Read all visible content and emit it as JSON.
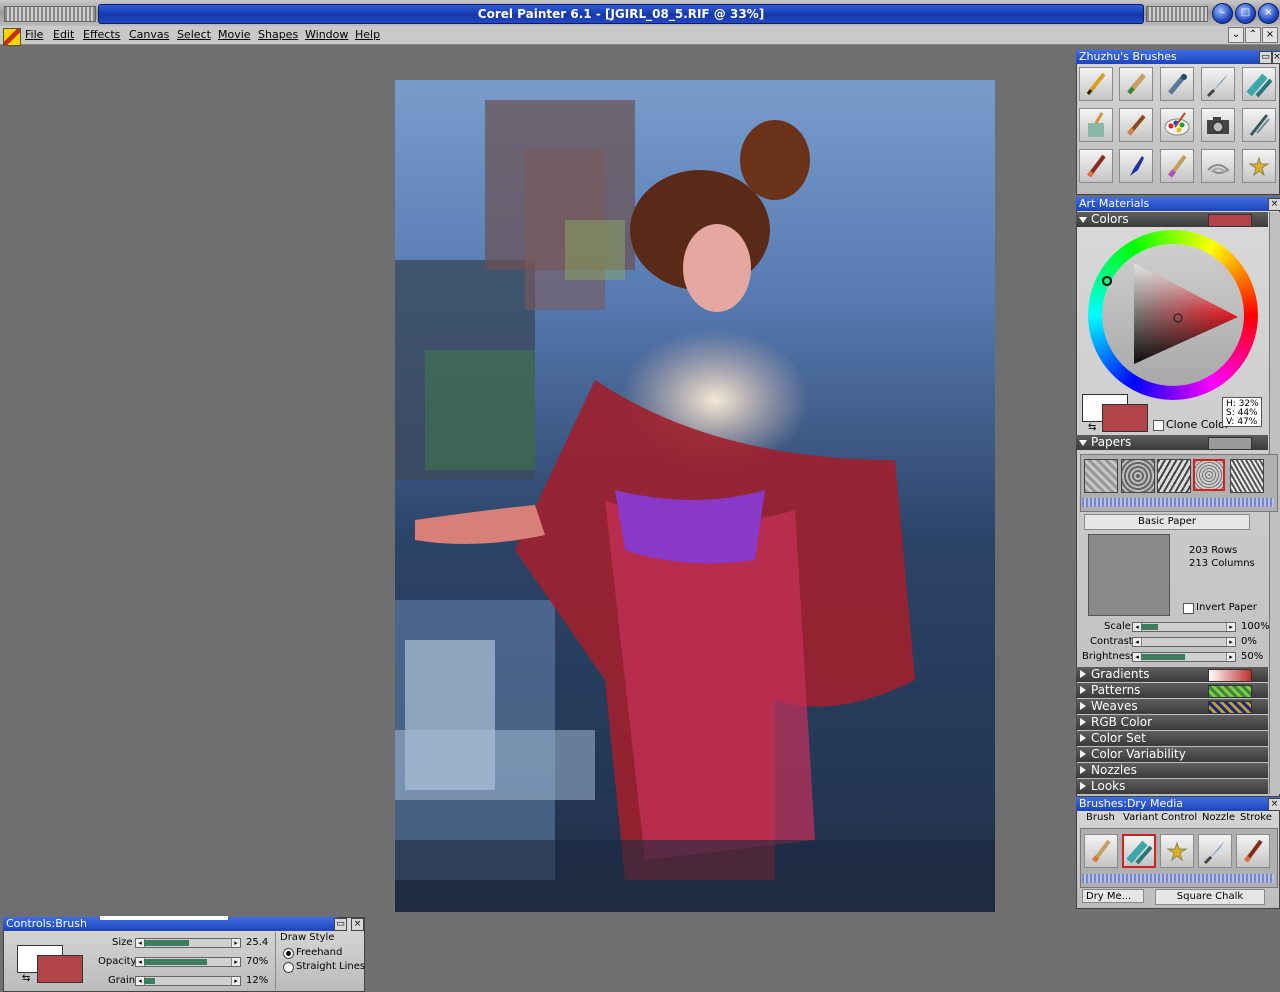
{
  "window": {
    "title": "Corel Painter 6.1 - [JGIRL_08_5.RIF @ 33%]"
  },
  "menu": [
    "File",
    "Edit",
    "Effects",
    "Canvas",
    "Select",
    "Movie",
    "Shapes",
    "Window",
    "Help"
  ],
  "brushes_palette": {
    "title": "Zhuzhu's Brushes",
    "tools": [
      "pencil-icon",
      "felt-pen-icon",
      "airbrush-icon",
      "palette-knife-icon",
      "chalk-icon",
      "paint-bucket-icon",
      "oil-brush-icon",
      "color-wheel-icon",
      "camera-icon",
      "pen-nib-icon",
      "brush-icon",
      "ink-pen-icon",
      "watercolor-icon",
      "liquid-swirl-icon",
      "image-hose-icon"
    ]
  },
  "art_materials": {
    "title": "Art Materials",
    "colors": {
      "label": "Colors",
      "clone_color_label": "Clone Color",
      "hsv": [
        "H: 32%",
        "S: 44%",
        "V: 47%"
      ],
      "primary_color": "#b04448",
      "secondary_color": "#ffffff"
    },
    "papers": {
      "label": "Papers",
      "selected_name": "Basic Paper",
      "rows": "203 Rows",
      "columns": "213 Columns",
      "invert_label": "Invert Paper",
      "sliders": [
        {
          "label": "Scale",
          "value": "100%",
          "level": 0.12
        },
        {
          "label": "Contrast",
          "value": "0%",
          "level": 0.0
        },
        {
          "label": "Brightness",
          "value": "50%",
          "level": 0.5
        }
      ]
    },
    "collapsed_sections": [
      "Gradients",
      "Patterns",
      "Weaves",
      "RGB Color",
      "Color Set",
      "Color Variability",
      "Nozzles",
      "Looks"
    ]
  },
  "dry_media": {
    "title": "Brushes:Dry Media",
    "tabs": [
      "Brush",
      "Variant",
      "Control",
      "Nozzle",
      "Stroke"
    ],
    "category": "Dry Me...",
    "variant": "Square Chalk"
  },
  "controls_brush": {
    "title": "Controls:Brush",
    "sliders": [
      {
        "label": "Size",
        "value": "25.4",
        "level": 0.5
      },
      {
        "label": "Opacity",
        "value": "70%",
        "level": 0.7
      },
      {
        "label": "Grain",
        "value": "12%",
        "level": 0.12
      }
    ],
    "draw_style_label": "Draw Style",
    "draw_styles": [
      "Freehand",
      "Straight Lines"
    ],
    "selected_style": "Freehand"
  }
}
